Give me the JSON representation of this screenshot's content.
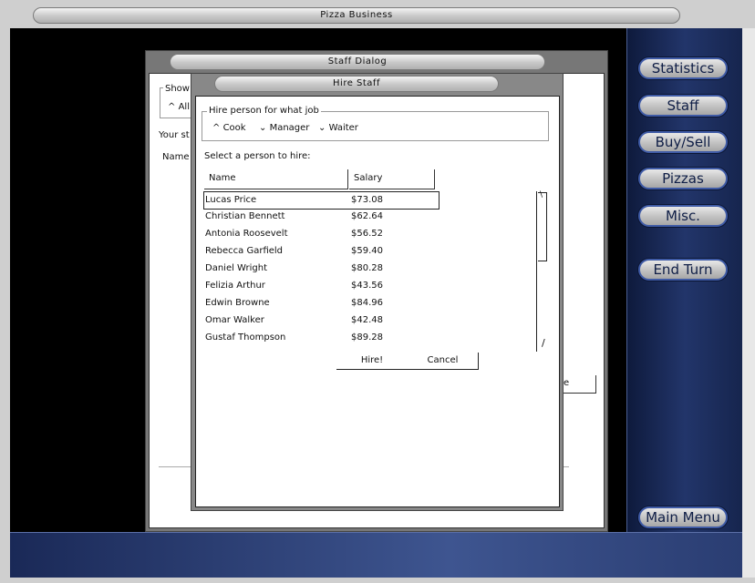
{
  "app": {
    "title": "Pizza Business"
  },
  "sidebar": {
    "buttons": [
      "Statistics",
      "Staff",
      "Buy/Sell",
      "Pizzas",
      "Misc."
    ],
    "end_turn": "End Turn",
    "main_menu": "Main Menu"
  },
  "staff_dialog": {
    "title": "Staff Dialog",
    "show_label": "Show",
    "all_option": "All",
    "your_staff_label": "Your st",
    "name_header": "Name",
    "partial_button": "e"
  },
  "hire_dialog": {
    "title": "Hire Staff",
    "job_group_label": "Hire person for what job",
    "jobs": [
      "Cook",
      "Manager",
      "Waiter"
    ],
    "selected_job": "Cook",
    "select_label": "Select a person to hire:",
    "columns": [
      "Name",
      "Salary"
    ],
    "candidates": [
      {
        "name": "Lucas Price",
        "salary": "$73.08"
      },
      {
        "name": "Christian Bennett",
        "salary": "$62.64"
      },
      {
        "name": "Antonia Roosevelt",
        "salary": "$56.52"
      },
      {
        "name": "Rebecca Garfield",
        "salary": "$59.40"
      },
      {
        "name": "Daniel Wright",
        "salary": "$80.28"
      },
      {
        "name": "Felizia Arthur",
        "salary": "$43.56"
      },
      {
        "name": "Edwin Browne",
        "salary": "$84.96"
      },
      {
        "name": "Omar Walker",
        "salary": "$42.48"
      },
      {
        "name": "Gustaf Thompson",
        "salary": "$89.28"
      }
    ],
    "hire_button": "Hire!",
    "cancel_button": "Cancel"
  },
  "colors": {
    "panel": "#22356a",
    "button_border": "#3f5ba6",
    "button_text": "#0f1e46"
  }
}
